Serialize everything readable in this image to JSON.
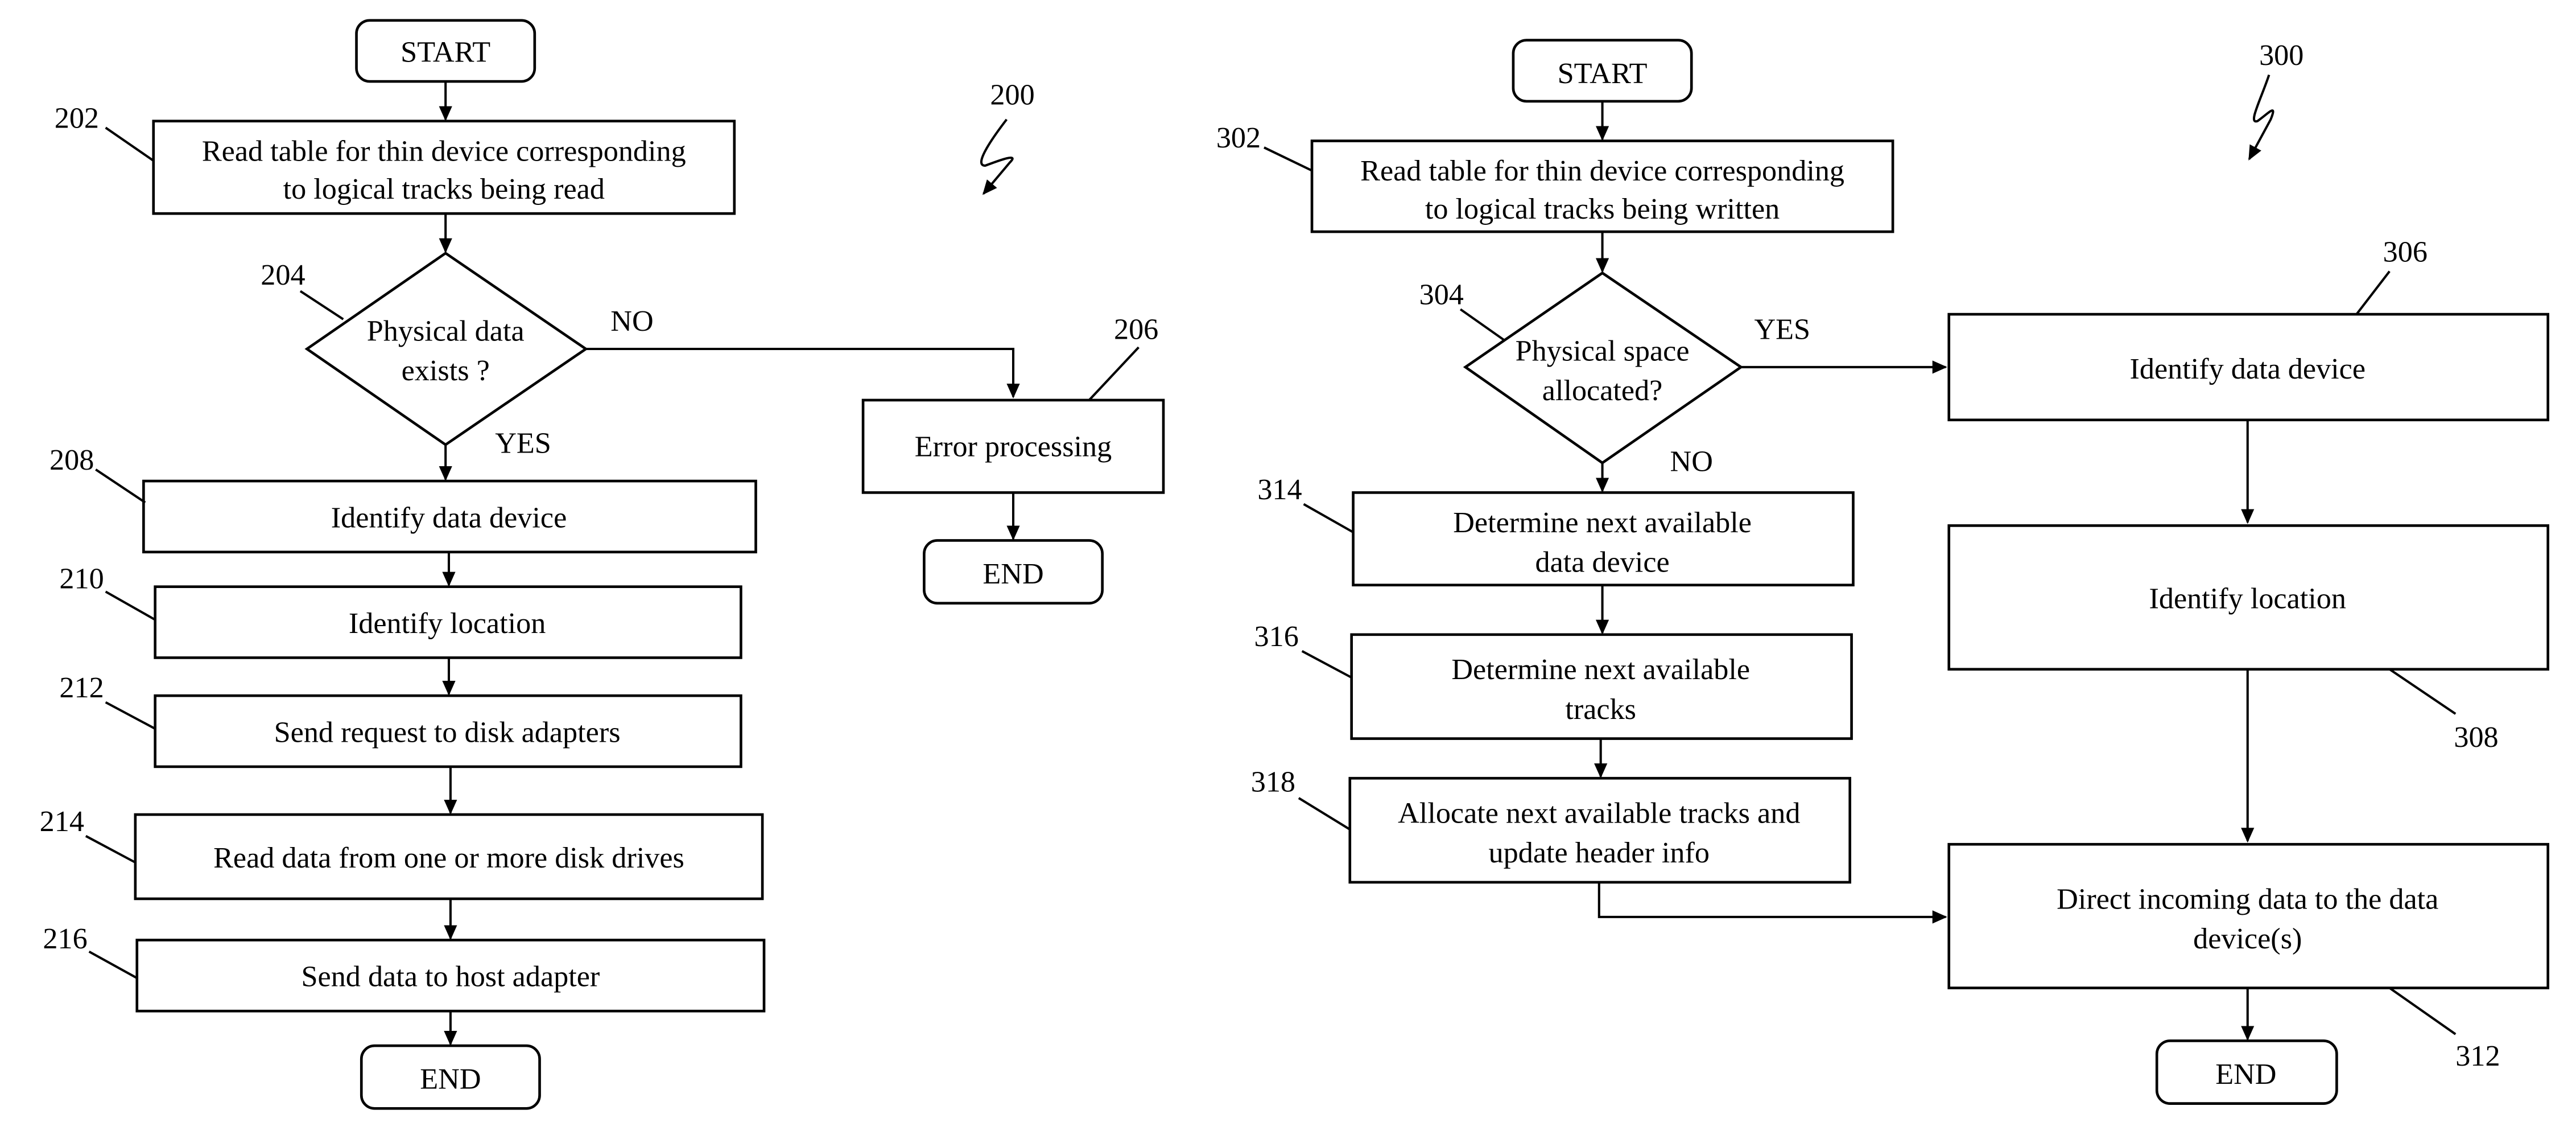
{
  "figures": [
    {
      "ref": "200",
      "nodes": {
        "start": "START",
        "n202": [
          "Read table for thin device corresponding",
          "to logical tracks being read"
        ],
        "n204": [
          "Physical data",
          "exists ?"
        ],
        "n206": "Error processing",
        "end206": "END",
        "n208": "Identify data device",
        "n210": "Identify location",
        "n212": "Send request to disk adapters",
        "n214": "Read data from one or more disk drives",
        "n216": "Send data to host adapter",
        "end": "END"
      },
      "branch_no": "NO",
      "branch_yes": "YES",
      "refs": {
        "r202": "202",
        "r204": "204",
        "r206": "206",
        "r208": "208",
        "r210": "210",
        "r212": "212",
        "r214": "214",
        "r216": "216"
      }
    },
    {
      "ref": "300",
      "nodes": {
        "start": "START",
        "n302": [
          "Read table for thin device corresponding",
          "to logical tracks being written"
        ],
        "n304": [
          "Physical space",
          "allocated?"
        ],
        "n306": "Identify data device",
        "n308": "Identify location",
        "n312": [
          "Direct incoming data to the data",
          "device(s)"
        ],
        "n314": [
          "Determine next available",
          "data device"
        ],
        "n316": [
          "Determine next available",
          "tracks"
        ],
        "n318": [
          "Allocate next available tracks and",
          "update header info"
        ],
        "end": "END"
      },
      "branch_yes": "YES",
      "branch_no": "NO",
      "refs": {
        "r302": "302",
        "r304": "304",
        "r306": "306",
        "r308": "308",
        "r312": "312",
        "r314": "314",
        "r316": "316",
        "r318": "318"
      }
    }
  ]
}
